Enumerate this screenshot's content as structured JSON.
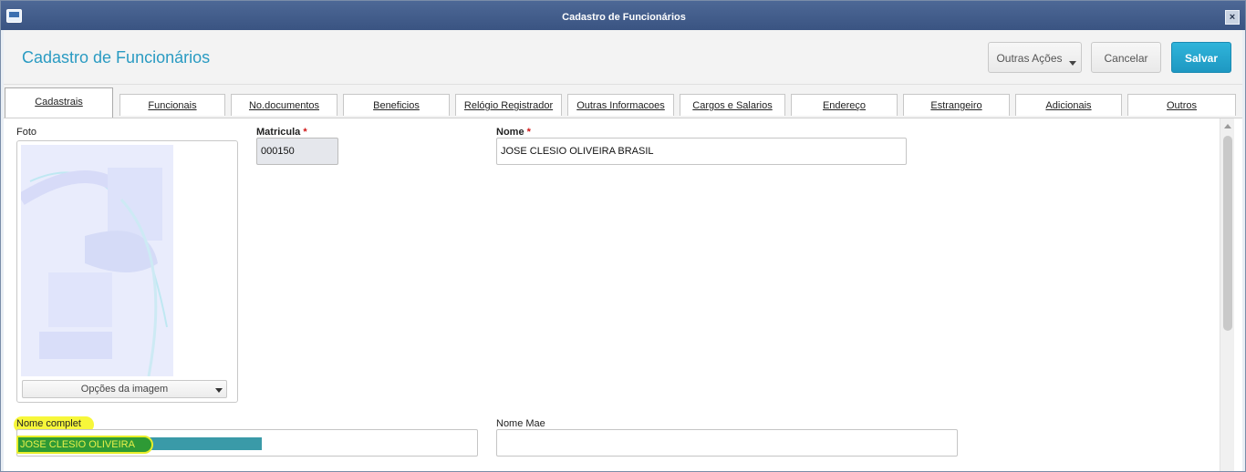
{
  "window": {
    "title": "Cadastro de Funcionários",
    "close_label": "×"
  },
  "header": {
    "title": "Cadastro de Funcionários",
    "outras_acoes_label": "Outras Ações",
    "cancelar_label": "Cancelar",
    "salvar_label": "Salvar"
  },
  "tabs": [
    {
      "label": "Cadastrais",
      "active": true
    },
    {
      "label": "Funcionais",
      "active": false
    },
    {
      "label": "No.documentos",
      "active": false
    },
    {
      "label": "Beneficios",
      "active": false
    },
    {
      "label": "Relógio Registrador",
      "active": false
    },
    {
      "label": "Outras Informacoes",
      "active": false
    },
    {
      "label": "Cargos e Salarios",
      "active": false
    },
    {
      "label": "Endereço",
      "active": false
    },
    {
      "label": "Estrangeiro",
      "active": false
    },
    {
      "label": "Adicionais",
      "active": false
    },
    {
      "label": "Outros",
      "active": false
    }
  ],
  "form": {
    "foto_label": "Foto",
    "image_options_label": "Opções da imagem",
    "matricula_label": "Matricula",
    "matricula_value": "000150",
    "nome_label": "Nome",
    "nome_value": "JOSE CLESIO OLIVEIRA BRASIL",
    "nome_completo_label": "Nome complet",
    "nome_completo_value": "JOSE CLESIO OLIVEIRA",
    "nome_mae_label": "Nome Mae",
    "nome_mae_value": "",
    "required_mark": "*"
  },
  "colors": {
    "accent": "#2a9bc2",
    "title_bar": "#3e5886",
    "required": "#d01818",
    "highlight_yellow": "#f7f73a",
    "highlight_green": "#2e9a35"
  },
  "icons": [
    "window-icon",
    "close-icon",
    "chevron-down-icon"
  ]
}
